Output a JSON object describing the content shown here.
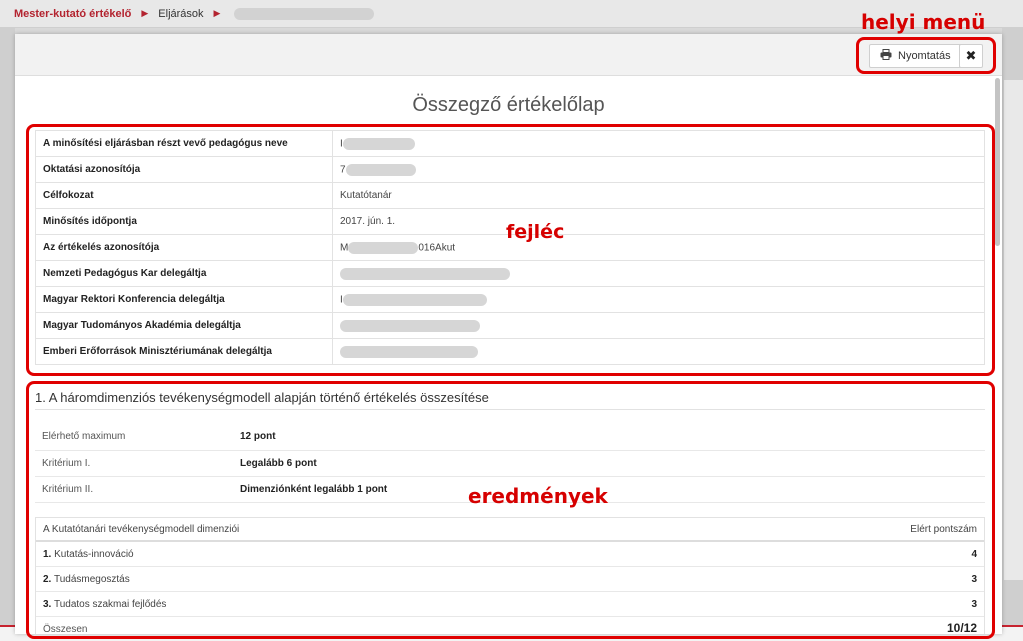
{
  "breadcrumb": {
    "root": "Mester-kutató értékelő",
    "item": "Eljárások"
  },
  "modal": {
    "print_label": "Nyomtatás",
    "close_symbol": "✖",
    "title": "Összegző értékelőlap"
  },
  "header_rows": [
    {
      "label": "A minősítési eljárásban részt vevő pedagógus neve",
      "value": "I"
    },
    {
      "label": "Oktatási azonosítója",
      "value": "7"
    },
    {
      "label": "Célfokozat",
      "value": "Kutatótanár"
    },
    {
      "label": "Minősítés időpontja",
      "value": "2017. jún. 1."
    },
    {
      "label": "Az értékelés azonosítója",
      "value_prefix": "M",
      "value_suffix": "016Akut"
    },
    {
      "label": "Nemzeti Pedagógus Kar delegáltja",
      "value": ""
    },
    {
      "label": "Magyar Rektori Konferencia delegáltja",
      "value": "I"
    },
    {
      "label": "Magyar Tudományos Akadémia delegáltja",
      "value": ""
    },
    {
      "label": "Emberi Erőforrások Minisztériumának delegáltja",
      "value": ""
    }
  ],
  "section": {
    "title": "1. A háromdimenziós tevékenységmodell alapján történő értékelés összesítése",
    "criteria": [
      {
        "label": "Elérhető maximum",
        "value": "12 pont"
      },
      {
        "label": "Kritérium I.",
        "value": "Legalább 6 pont"
      },
      {
        "label": "Kritérium II.",
        "value": "Dimenziónként legalább 1 pont"
      }
    ],
    "dimensions_header": "A Kutatótanári tevékenységmodell dimenziói",
    "points_header": "Elért pontszám",
    "dimensions": [
      {
        "num": "1.",
        "name": "Kutatás-innováció",
        "points": "4"
      },
      {
        "num": "2.",
        "name": "Tudásmegosztás",
        "points": "3"
      },
      {
        "num": "3.",
        "name": "Tudatos szakmai fejlődés",
        "points": "3"
      }
    ],
    "sum_label": "Összesen",
    "sum_points": "10/12"
  },
  "annotations": {
    "menu": "helyi menü",
    "header": "fejléc",
    "results": "eredmények"
  },
  "colors": {
    "accent": "#b3232f",
    "annotation": "#e00000"
  }
}
